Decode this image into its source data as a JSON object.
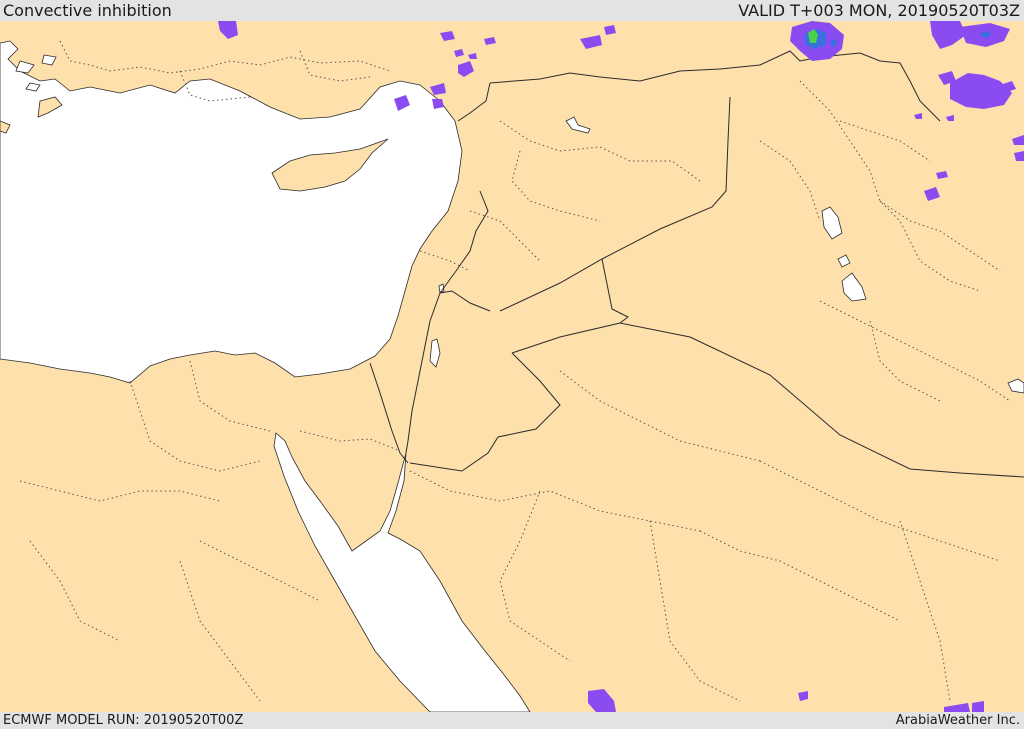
{
  "header": {
    "title": "Convective inhibition",
    "valid": "VALID T+003 MON, 20190520T03Z"
  },
  "footer": {
    "model_run": "ECMWF MODEL RUN: 20190520T00Z",
    "credit": "ArabiaWeather Inc."
  },
  "colors": {
    "land": "#fde0ab",
    "sea": "#ffffff",
    "cin_purple": "#8a4cf0",
    "cin_blue": "#3a6fe0",
    "cin_green": "#4cd24c",
    "bar": "#e3e3e3"
  }
}
